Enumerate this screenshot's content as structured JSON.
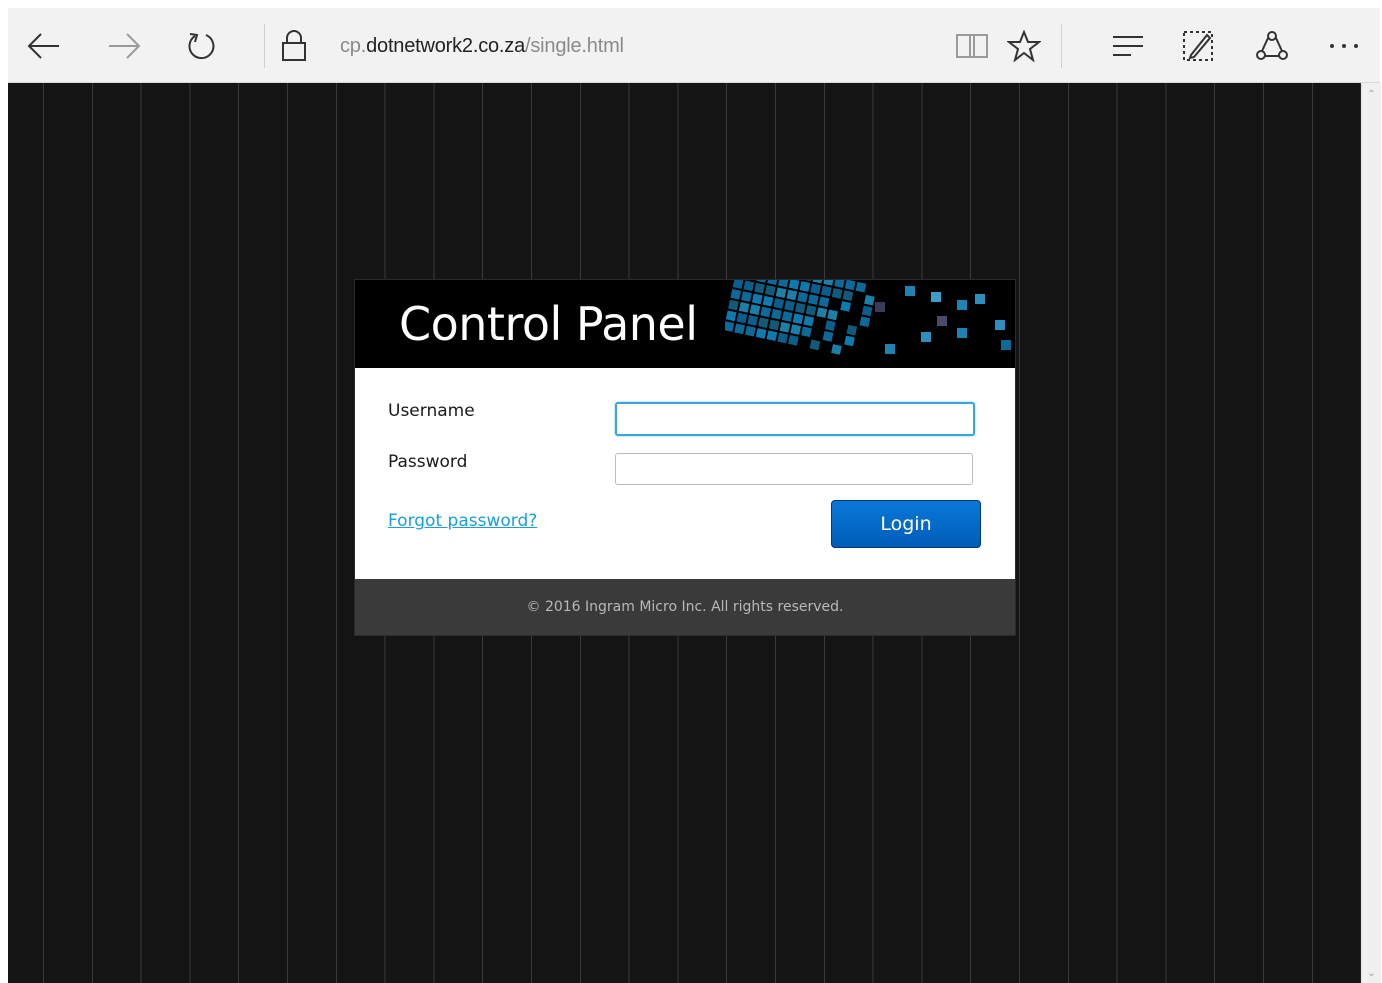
{
  "browser": {
    "address": {
      "prefix": "cp.",
      "host": "dotnetwork2.co.za",
      "path": "/single.html"
    },
    "icons": [
      "back-arrow-icon",
      "forward-arrow-icon",
      "refresh-icon",
      "lock-icon",
      "reading-view-icon",
      "favorite-star-icon",
      "hub-icon",
      "web-note-icon",
      "share-icon",
      "more-icon"
    ]
  },
  "login": {
    "title": "Control Panel",
    "username_label": "Username",
    "password_label": "Password",
    "username_value": "",
    "password_value": "",
    "forgot_link": "Forgot password?",
    "login_button": "Login",
    "footer": "© 2016 Ingram Micro Inc. All rights reserved."
  },
  "colors": {
    "accent_blue": "#0a6fd0",
    "link_blue": "#1a9fd6",
    "header_black": "#000000",
    "footer_gray": "#3a3a3a",
    "page_bg": "#141414"
  }
}
